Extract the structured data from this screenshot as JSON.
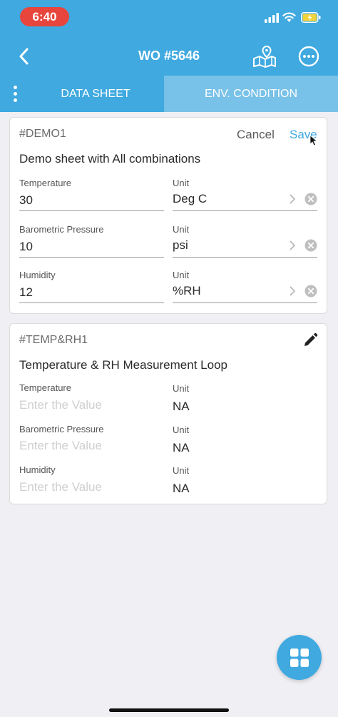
{
  "status_bar": {
    "time": "6:40",
    "icons": [
      "cellular-signal-icon",
      "wifi-icon",
      "battery-charging-icon"
    ]
  },
  "nav": {
    "title": "WO #5646",
    "back_icon": "chevron-left-icon",
    "map_icon": "map-location-icon",
    "more_icon": "more-horizontal-icon"
  },
  "tabs": [
    {
      "label": "DATA SHEET",
      "active": true
    },
    {
      "label": "ENV. CONDITION",
      "active": false
    }
  ],
  "colors": {
    "primary": "#3fa9e0",
    "tab_inactive": "#78c1e8",
    "time_pill": "#e8453c",
    "background": "#efeff4"
  },
  "datasheet_edit": {
    "id": "#DEMO1",
    "cancel_label": "Cancel",
    "save_label": "Save",
    "title": "Demo sheet with All combinations",
    "rows": [
      {
        "label": "Temperature",
        "value": "30",
        "unit_label": "Unit",
        "unit": "Deg C"
      },
      {
        "label": "Barometric Pressure",
        "value": "10",
        "unit_label": "Unit",
        "unit": "psi"
      },
      {
        "label": "Humidity",
        "value": "12",
        "unit_label": "Unit",
        "unit": "%RH"
      }
    ]
  },
  "datasheet_view": {
    "id": "#TEMP&RH1",
    "edit_icon": "pencil-icon",
    "title": "Temperature & RH Measurement Loop",
    "rows": [
      {
        "label": "Temperature",
        "placeholder": "Enter the Value",
        "unit_label": "Unit",
        "unit": "NA"
      },
      {
        "label": "Barometric Pressure",
        "placeholder": "Enter the Value",
        "unit_label": "Unit",
        "unit": "NA"
      },
      {
        "label": "Humidity",
        "placeholder": "Enter the Value",
        "unit_label": "Unit",
        "unit": "NA"
      }
    ]
  },
  "fab": {
    "icon": "grid-apps-icon"
  }
}
